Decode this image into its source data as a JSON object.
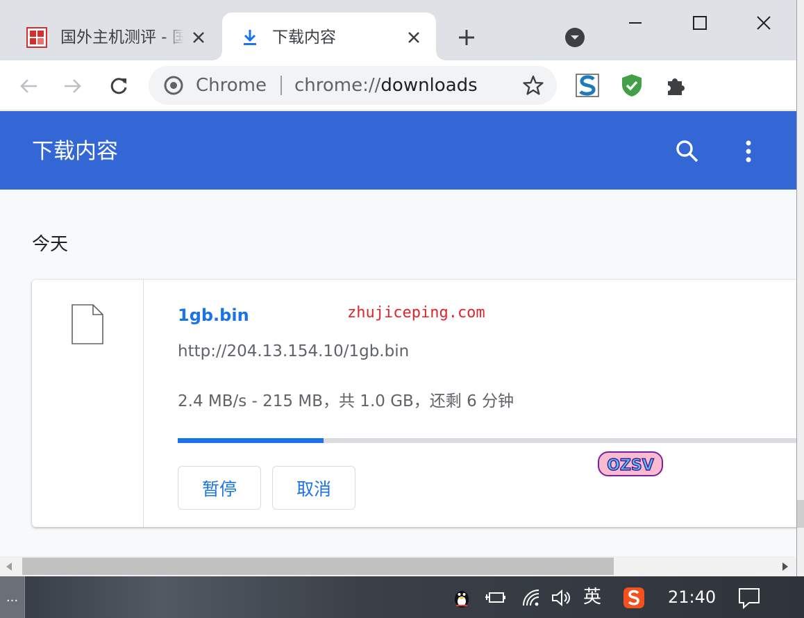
{
  "tabs": [
    {
      "title": "国外主机测评 - 国",
      "active": false
    },
    {
      "title": "下载内容",
      "active": true
    }
  ],
  "omnibox": {
    "site_label": "Chrome",
    "url_scheme": "chrome://",
    "url_path": "downloads"
  },
  "downloads": {
    "page_title": "下载内容",
    "section_date": "今天",
    "item": {
      "file_name": "1gb.bin",
      "watermark": "zhujiceping.com",
      "url": "http://204.13.154.10/1gb.bin",
      "status": "2.4 MB/s - 215 MB，共 1.0 GB，还剩 6 分钟",
      "progress_fraction": 0.231,
      "pause_label": "暂停",
      "cancel_label": "取消"
    }
  },
  "taskbar": {
    "app_label": "...",
    "ime": "英",
    "clock": "21:40",
    "sticker_text": "OZSV"
  },
  "colors": {
    "accent": "#3367d6",
    "link": "#1a73e8",
    "watermark": "#e0242a"
  }
}
